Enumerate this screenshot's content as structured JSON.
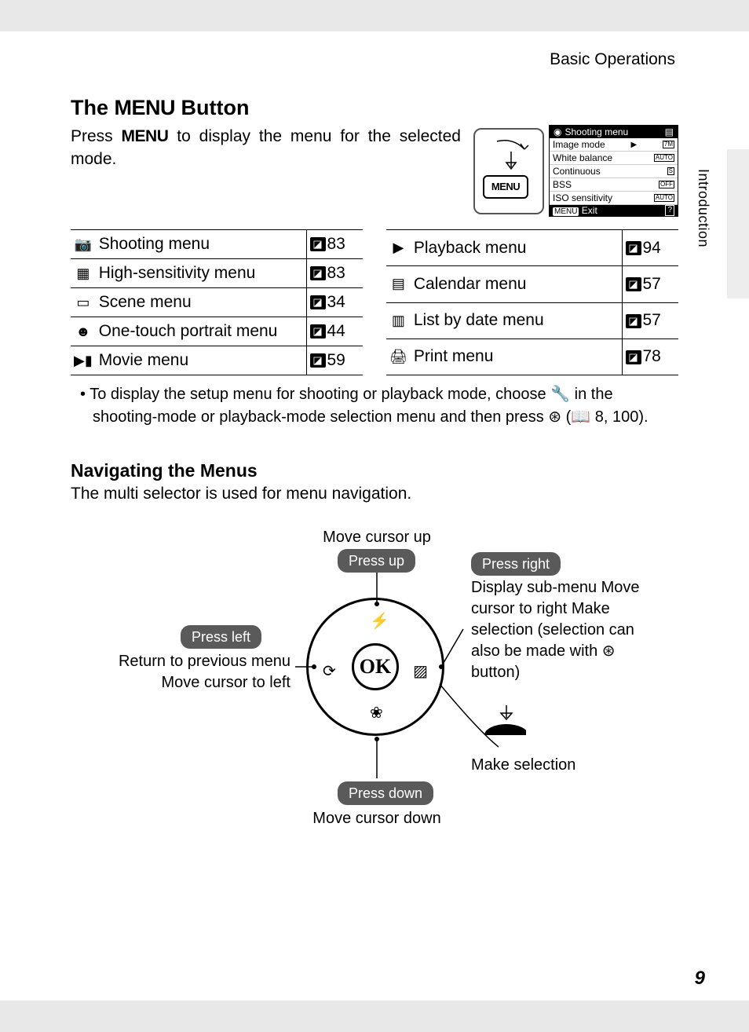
{
  "section_header": "Basic Operations",
  "side_tab": "Introduction",
  "title_pre": "The ",
  "title_menu": "MENU",
  "title_post": " Button",
  "intro_pre": "Press ",
  "intro_menu": "MENU",
  "intro_post": " to display the menu for the selected mode.",
  "lcd": {
    "header": "Shooting menu",
    "rows": [
      {
        "label": "Image mode",
        "badge": "7M"
      },
      {
        "label": "White balance",
        "badge": "AUTO"
      },
      {
        "label": "Continuous",
        "badge": "S"
      },
      {
        "label": "BSS",
        "badge": "OFF"
      },
      {
        "label": "ISO sensitivity",
        "badge": "AUTO"
      }
    ],
    "footer_left": "MENU",
    "footer_exit": "Exit",
    "footer_right": "?"
  },
  "left_menu": [
    {
      "icon": "📷",
      "label": "Shooting menu",
      "page": "83"
    },
    {
      "icon": "▦",
      "label": "High-sensitivity menu",
      "page": "83"
    },
    {
      "icon": "▭",
      "label": "Scene menu",
      "page": "34"
    },
    {
      "icon": "☻",
      "label": "One-touch portrait menu",
      "page": "44"
    },
    {
      "icon": "▶▮",
      "label": "Movie menu",
      "page": "59"
    }
  ],
  "right_menu": [
    {
      "icon": "▶",
      "label": "Playback menu",
      "page": "94"
    },
    {
      "icon": "▤",
      "label": "Calendar menu",
      "page": "57"
    },
    {
      "icon": "▥",
      "label": "List by date menu",
      "page": "57"
    },
    {
      "icon": "🖨",
      "label": "Print menu",
      "page": "78"
    }
  ],
  "bullet_text": "To display the setup menu for shooting or playback mode, choose 🔧 in the shooting-mode or playback-mode selection menu and then press ⊛ (📖 8, 100).",
  "nav_heading": "Navigating the Menus",
  "nav_text": "The multi selector is used for menu navigation.",
  "diagram": {
    "up_label": "Move cursor up",
    "up_pill": "Press up",
    "down_label": "Move cursor down",
    "down_pill": "Press down",
    "left_pill": "Press left",
    "left_text": "Return to previous menu\nMove cursor to left",
    "right_pill": "Press right",
    "right_text": "Display sub-menu\nMove cursor to right\nMake selection (selection can also be made with ⊛ button)",
    "make_selection": "Make selection",
    "ok": "OK"
  },
  "page_number": "9"
}
